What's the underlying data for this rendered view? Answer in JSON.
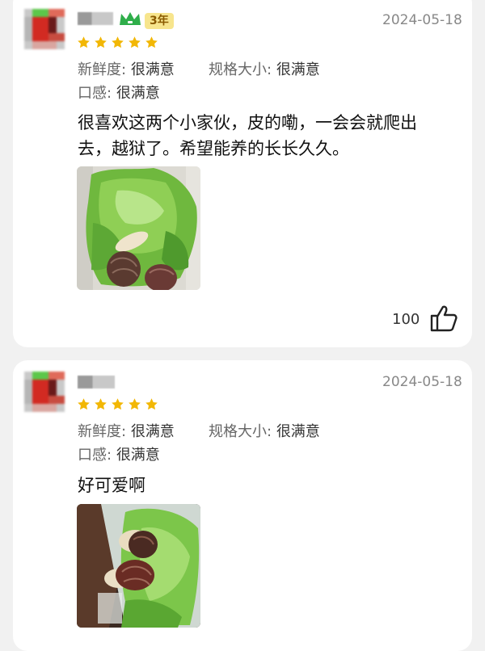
{
  "reviews": [
    {
      "level": "3年",
      "date": "2024-05-18",
      "rating": 5,
      "attr1_key": "新鲜度:",
      "attr1_val": "很满意",
      "attr2_key": "规格大小:",
      "attr2_val": "很满意",
      "attr3_key": "口感:",
      "attr3_val": "很满意",
      "text_line1": "很喜欢这两个小家伙，皮的嘞，一会会就爬出",
      "text_line2": "去，越狱了。希望能养的长长久久。",
      "likes": "100"
    },
    {
      "date": "2024-05-18",
      "rating": 5,
      "attr1_key": "新鲜度:",
      "attr1_val": "很满意",
      "attr2_key": "规格大小:",
      "attr2_val": "很满意",
      "attr3_key": "口感:",
      "attr3_val": "很满意",
      "text_line1": "好可爱啊"
    }
  ],
  "colors": {
    "star": "#f2b705",
    "crown": "#2fae4a",
    "badge_bg": "#f7e58d",
    "date": "#888888"
  },
  "icons": [
    "crown-icon",
    "star-icon",
    "thumbs-up-icon"
  ]
}
